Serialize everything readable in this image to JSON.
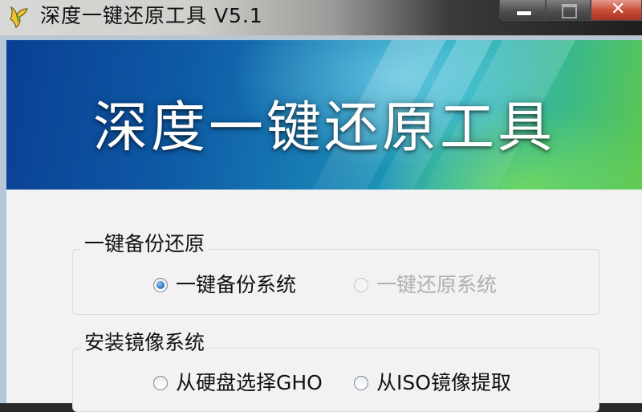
{
  "window": {
    "title": "深度一键还原工具 V5.1",
    "close_symbol": "✕"
  },
  "banner": {
    "title": "深度一键还原工具"
  },
  "groups": [
    {
      "title": "一键备份还原",
      "options": [
        {
          "label": "一键备份系统",
          "selected": true,
          "enabled": true
        },
        {
          "label": "一键还原系统",
          "selected": false,
          "enabled": false
        }
      ]
    },
    {
      "title": "安装镜像系统",
      "options": [
        {
          "label": "从硬盘选择GHO",
          "selected": false,
          "enabled": true
        },
        {
          "label": "从ISO镜像提取",
          "selected": false,
          "enabled": true
        }
      ]
    }
  ],
  "icons": {
    "app": "deepin-app-icon",
    "minimize": "minimize-icon",
    "maximize": "maximize-icon",
    "close": "close-icon"
  },
  "colors": {
    "accent": "#2a6fb8",
    "close_button": "#c9503a",
    "banner_start": "#0a3f93",
    "banner_end": "#5fc84e"
  }
}
